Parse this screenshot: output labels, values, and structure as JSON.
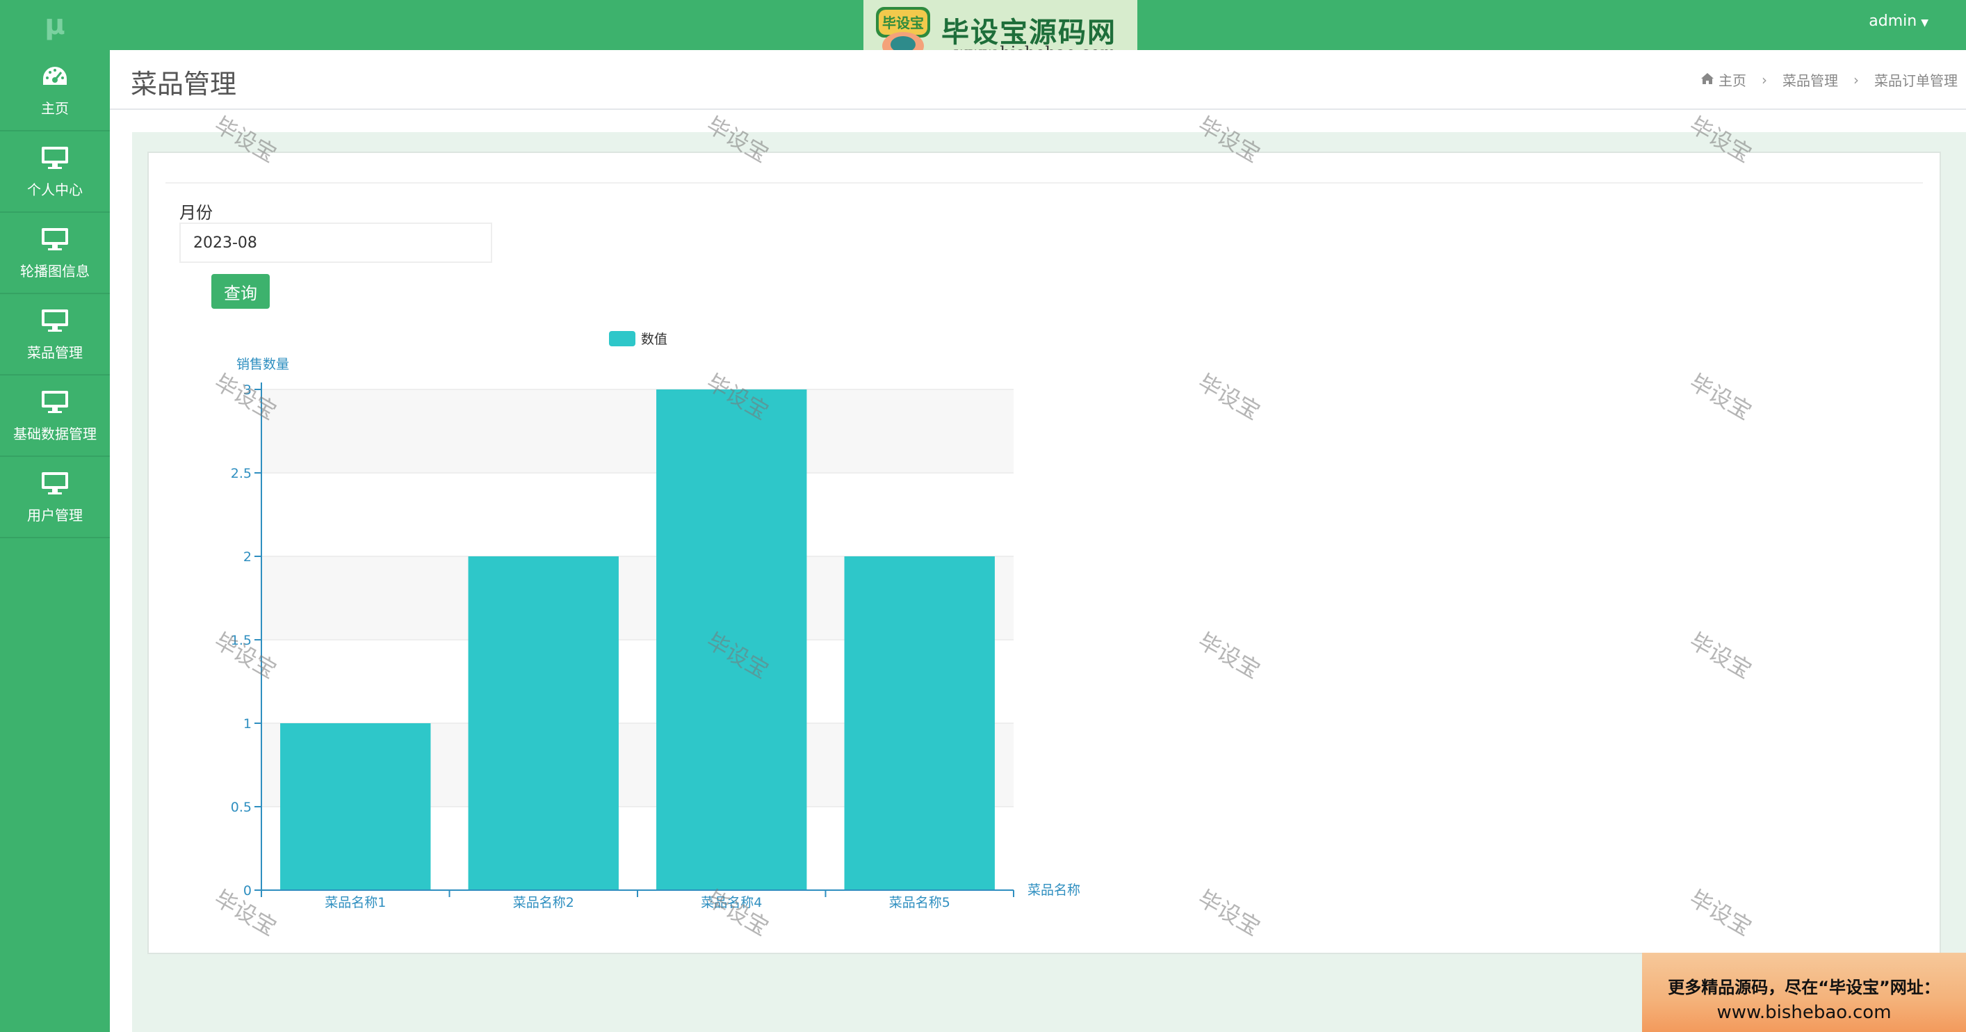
{
  "sidebar": {
    "logo": "μ",
    "items": [
      {
        "label": "主页",
        "icon": "dashboard-icon"
      },
      {
        "label": "个人中心",
        "icon": "monitor-icon"
      },
      {
        "label": "轮播图信息",
        "icon": "monitor-icon"
      },
      {
        "label": "菜品管理",
        "icon": "monitor-icon"
      },
      {
        "label": "基础数据管理",
        "icon": "monitor-icon"
      },
      {
        "label": "用户管理",
        "icon": "monitor-icon"
      }
    ]
  },
  "topbar": {
    "user": "admin"
  },
  "brand": {
    "logo_text": "毕设宝",
    "name": "毕设宝源码网",
    "url": "www.bishebao.com"
  },
  "header": {
    "title": "菜品管理",
    "breadcrumb": [
      "主页",
      "菜品管理",
      "菜品订单管理"
    ]
  },
  "form": {
    "month_label": "月份",
    "month_value": "2023-08",
    "query_label": "查询"
  },
  "chart_data": {
    "type": "bar",
    "legend": [
      "数值"
    ],
    "ylabel": "销售数量",
    "xlabel": "菜品名称",
    "categories": [
      "菜品名称1",
      "菜品名称2",
      "菜品名称4",
      "菜品名称5"
    ],
    "series": [
      {
        "name": "数值",
        "values": [
          1,
          2,
          3,
          2
        ]
      }
    ],
    "ylim": [
      0,
      3
    ],
    "yticks": [
      "0",
      "0.5",
      "1",
      "1.5",
      "2",
      "2.5",
      "3"
    ],
    "color": "#2ec7c9"
  },
  "watermark": {
    "text": "毕设宝"
  },
  "promo": {
    "line1": "更多精品源码，尽在“毕设宝”网址：",
    "line2": "www.bishebao.com"
  }
}
